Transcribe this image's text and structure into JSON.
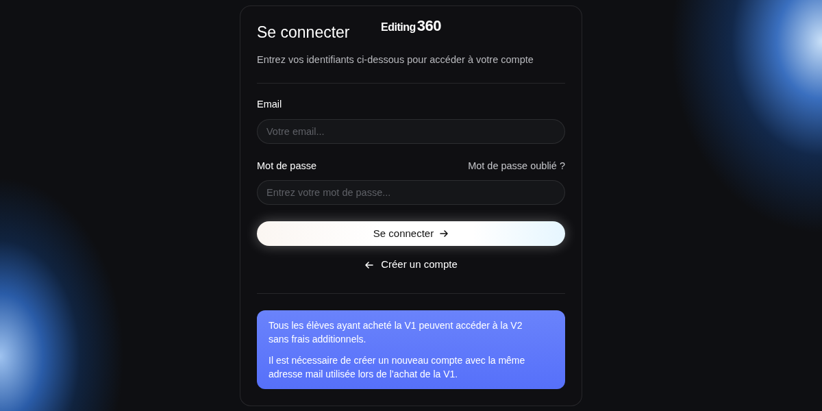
{
  "logo": {
    "word": "Editing",
    "number": "360"
  },
  "title": "Se connecter",
  "subtitle": "Entrez vos identifiants ci-dessous pour accéder à votre compte",
  "email": {
    "label": "Email",
    "placeholder": "Votre email..."
  },
  "password": {
    "label": "Mot de passe",
    "forgot_link": "Mot de passe oublié ?",
    "placeholder": "Entrez votre mot de passe..."
  },
  "submit_button": "Se connecter",
  "create_account_link": "Créer un compte",
  "notice": [
    "Tous les élèves ayant acheté la V1 peuvent accéder à la V2 sans frais additionnels.",
    "Il est nécessaire de créer un nouveau compte avec la même adresse mail utilisée lors de l’achat de la V1."
  ]
}
